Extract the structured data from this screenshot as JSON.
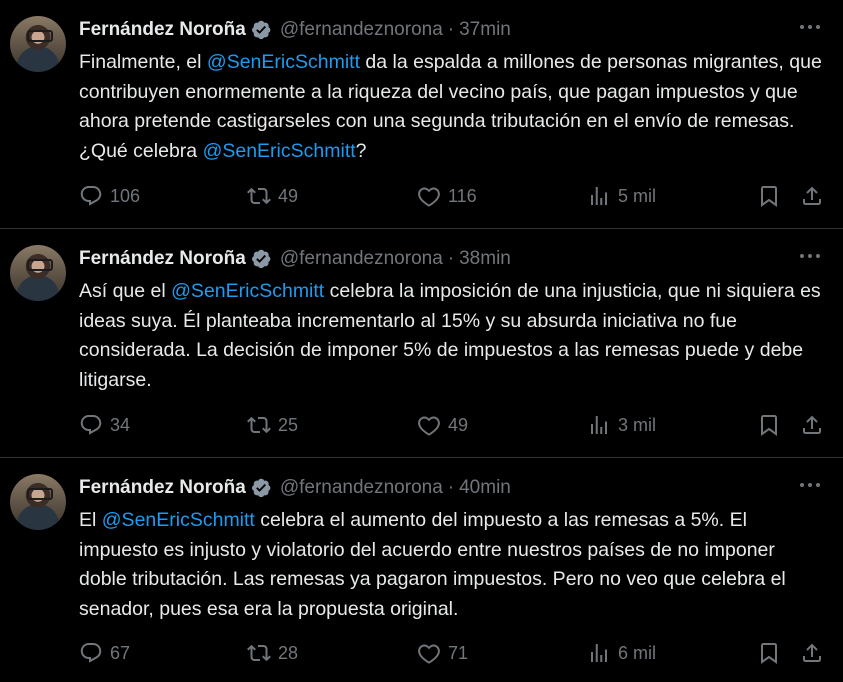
{
  "tweets": [
    {
      "author": "Fernández Noroña",
      "handle": "@fernandeznorona",
      "separator": "·",
      "time": "37min",
      "text_parts": [
        "Finalmente, el ",
        "@SenEricSchmitt",
        " da la espalda a millones de personas migrantes, que contribuyen enormemente a la riqueza del vecino país, que pagan impuestos y que ahora pretende castigarseles con una segunda tributación en el envío de remesas. ¿Qué celebra ",
        "@SenEricSchmitt",
        "?"
      ],
      "replies": "106",
      "retweets": "49",
      "likes": "116",
      "views": "5 mil"
    },
    {
      "author": "Fernández Noroña",
      "handle": "@fernandeznorona",
      "separator": "·",
      "time": "38min",
      "text_parts": [
        "Así que el ",
        "@SenEricSchmitt",
        " celebra la imposición de una injusticia, que ni siquiera es ideas suya. Él planteaba incrementarlo al 15% y su absurda iniciativa no fue considerada. La decisión de imponer 5% de impuestos a las remesas puede y debe litigarse.",
        "",
        ""
      ],
      "replies": "34",
      "retweets": "25",
      "likes": "49",
      "views": "3 mil"
    },
    {
      "author": "Fernández Noroña",
      "handle": "@fernandeznorona",
      "separator": "·",
      "time": "40min",
      "text_parts": [
        "El ",
        "@SenEricSchmitt",
        " celebra el aumento del impuesto a las remesas a 5%. El impuesto es injusto y violatorio del acuerdo entre nuestros países de no imponer doble tributación. Las remesas ya pagaron impuestos. Pero no veo que celebra el senador, pues esa era la propuesta original.",
        "",
        ""
      ],
      "replies": "67",
      "retweets": "28",
      "likes": "71",
      "views": "6 mil"
    }
  ],
  "icons": {
    "verified": "verified-badge-icon",
    "more": "more-dots-icon",
    "reply": "reply-icon",
    "retweet": "retweet-icon",
    "like": "like-heart-icon",
    "views": "views-chart-icon",
    "bookmark": "bookmark-icon",
    "share": "share-icon"
  },
  "colors": {
    "background": "#000000",
    "text": "#e7e9ea",
    "muted": "#71767b",
    "accent": "#1d9bf0",
    "divider": "#2f3336"
  }
}
